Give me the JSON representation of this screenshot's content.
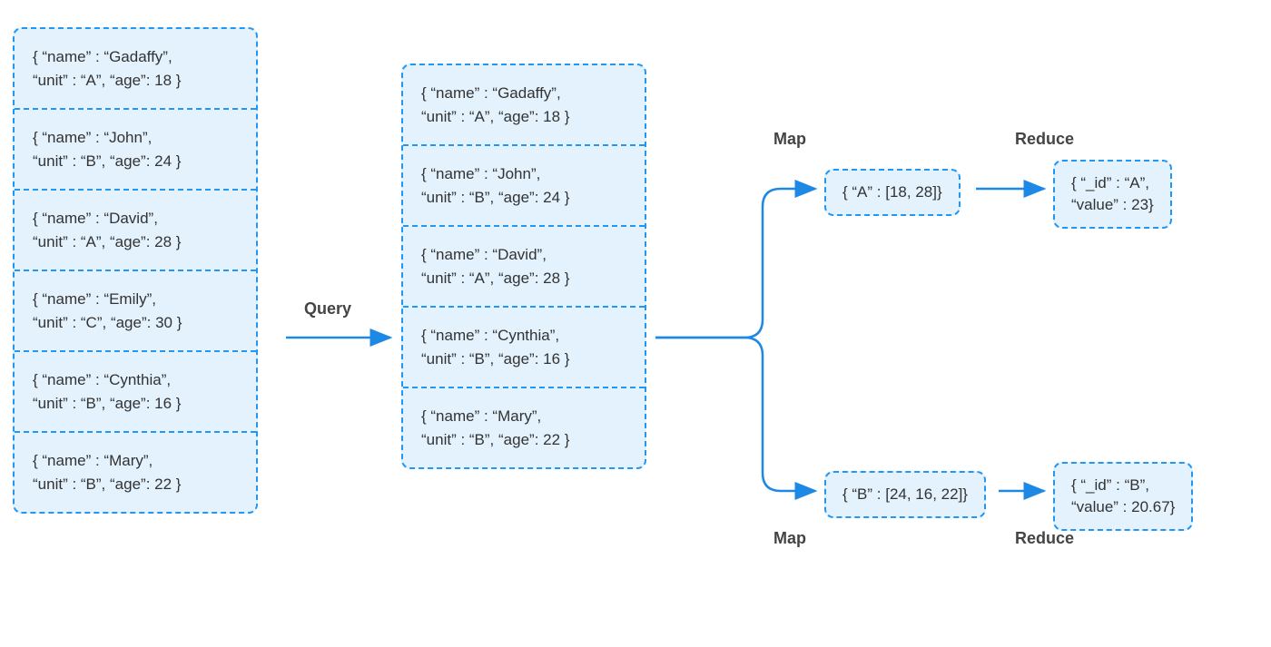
{
  "labels": {
    "query": "Query",
    "map_top": "Map",
    "map_bottom": "Map",
    "reduce_top": "Reduce",
    "reduce_bottom": "Reduce"
  },
  "source_records": [
    "{ “name” : “Gadaffy”,\n“unit” : “A”, “age”: 18 }",
    "{ “name” : “John”,\n“unit” : “B”, “age”: 24 }",
    "{ “name” : “David”,\n“unit” : “A”, “age”: 28 }",
    "{ “name” : “Emily”,\n“unit” : “C”, “age”: 30 }",
    "{ “name” : “Cynthia”,\n“unit” : “B”, “age”: 16 }",
    "{ “name” : “Mary”,\n“unit” : “B”, “age”: 22 }"
  ],
  "query_records": [
    "{ “name” : “Gadaffy”,\n“unit” : “A”, “age”: 18 }",
    "{ “name” : “John”,\n“unit” : “B”, “age”: 24 }",
    "{ “name” : “David”,\n“unit” : “A”, “age”: 28 }",
    "{ “name” : “Cynthia”,\n“unit” : “B”, “age”: 16 }",
    "{ “name” : “Mary”,\n“unit” : “B”, “age”: 22 }"
  ],
  "map_results": {
    "top": "{ “A” : [18, 28]}",
    "bottom": "{ “B” : [24, 16, 22]}"
  },
  "reduce_results": {
    "top": "{ “_id” : “A”,\n“value” : 23}",
    "bottom": "{ “_id” : “B”,\n“value” : 20.67}"
  },
  "chart_data": {
    "type": "diagram",
    "description": "MapReduce pipeline: source collection → query-filtered collection → map (group by unit, collect ages) → reduce (average age per unit)",
    "source": [
      {
        "name": "Gadaffy",
        "unit": "A",
        "age": 18
      },
      {
        "name": "John",
        "unit": "B",
        "age": 24
      },
      {
        "name": "David",
        "unit": "A",
        "age": 28
      },
      {
        "name": "Emily",
        "unit": "C",
        "age": 30
      },
      {
        "name": "Cynthia",
        "unit": "B",
        "age": 16
      },
      {
        "name": "Mary",
        "unit": "B",
        "age": 22
      }
    ],
    "after_query": [
      {
        "name": "Gadaffy",
        "unit": "A",
        "age": 18
      },
      {
        "name": "John",
        "unit": "B",
        "age": 24
      },
      {
        "name": "David",
        "unit": "A",
        "age": 28
      },
      {
        "name": "Cynthia",
        "unit": "B",
        "age": 16
      },
      {
        "name": "Mary",
        "unit": "B",
        "age": 22
      }
    ],
    "map": {
      "A": [
        18,
        28
      ],
      "B": [
        24,
        16,
        22
      ]
    },
    "reduce": [
      {
        "_id": "A",
        "value": 23
      },
      {
        "_id": "B",
        "value": 20.67
      }
    ]
  }
}
